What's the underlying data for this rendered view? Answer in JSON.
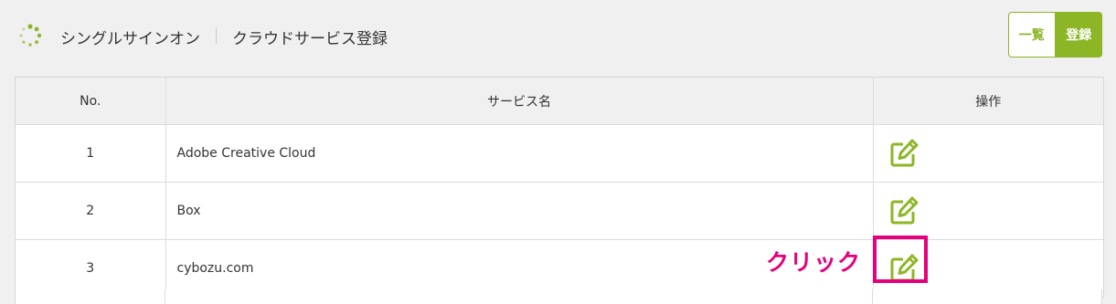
{
  "header": {
    "app_title": "シングルサインオン",
    "page_title": "クラウドサービス登録",
    "list_button": "一覧",
    "register_button": "登録"
  },
  "table": {
    "columns": [
      "No.",
      "サービス名",
      "操作"
    ],
    "rows": [
      {
        "no": "1",
        "name": "Adobe Creative Cloud"
      },
      {
        "no": "2",
        "name": "Box"
      },
      {
        "no": "3",
        "name": "cybozu.com"
      }
    ]
  },
  "annotation": {
    "label": "クリック"
  },
  "colors": {
    "accent": "#8cb626",
    "annotation": "#e5007e"
  },
  "icons": {
    "logo": "spinner-dots-icon",
    "edit": "edit-icon"
  }
}
